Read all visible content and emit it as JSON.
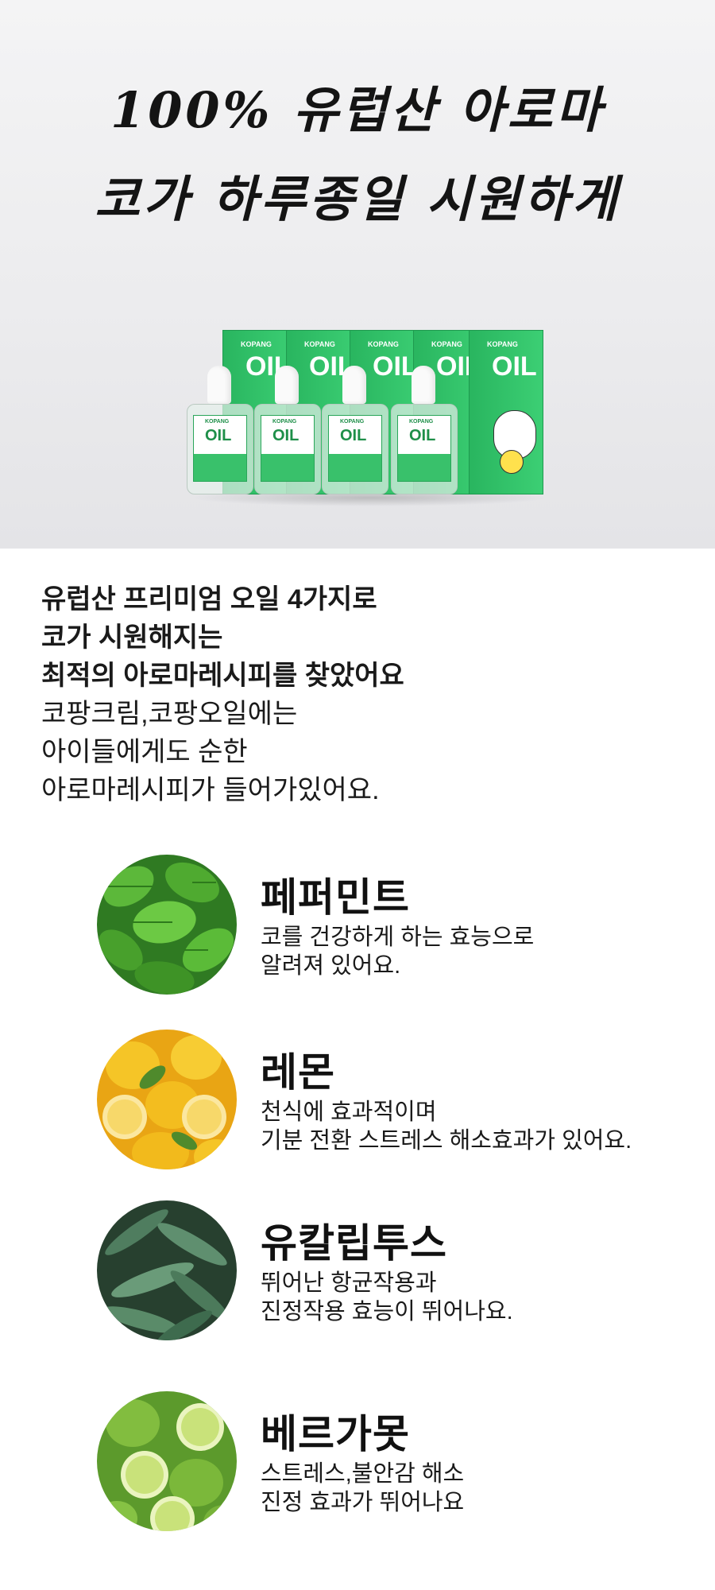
{
  "hero": {
    "title_line1": "100% 유럽산 아로마",
    "title_line2": "코가 하루종일 시원하게",
    "product": {
      "brand": "KOPANG",
      "name": "OIL"
    }
  },
  "intro": {
    "bold_lines": [
      "유럽산 프리미엄 오일 4가지로",
      "코가 시원해지는",
      "최적의 아로마레시피를 찾았어요"
    ],
    "regular_lines": [
      "코팡크림,코팡오일에는",
      "아이들에게도 순한",
      "아로마레시피가 들어가있어요."
    ]
  },
  "ingredients": [
    {
      "name": "페퍼민트",
      "desc_line1": "코를 건강하게 하는 효능으로",
      "desc_line2": "알려져 있어요.",
      "icon": "mint-leaves-image",
      "color": "#2f8a2a"
    },
    {
      "name": "레몬",
      "desc_line1": "천식에 효과적이며",
      "desc_line2": "기분 전환 스트레스 해소효과가 있어요.",
      "icon": "lemons-image",
      "color": "#f2b51c"
    },
    {
      "name": "유칼립투스",
      "desc_line1": "뛰어난 항균작용과",
      "desc_line2": "진정작용 효능이 뛰어나요.",
      "icon": "eucalyptus-leaves-image",
      "color": "#3f7155"
    },
    {
      "name": "베르가못",
      "desc_line1": "스트레스,불안감 해소",
      "desc_line2": "진정 효과가 뛰어나요",
      "icon": "bergamot-image",
      "color": "#8ac53e"
    }
  ]
}
